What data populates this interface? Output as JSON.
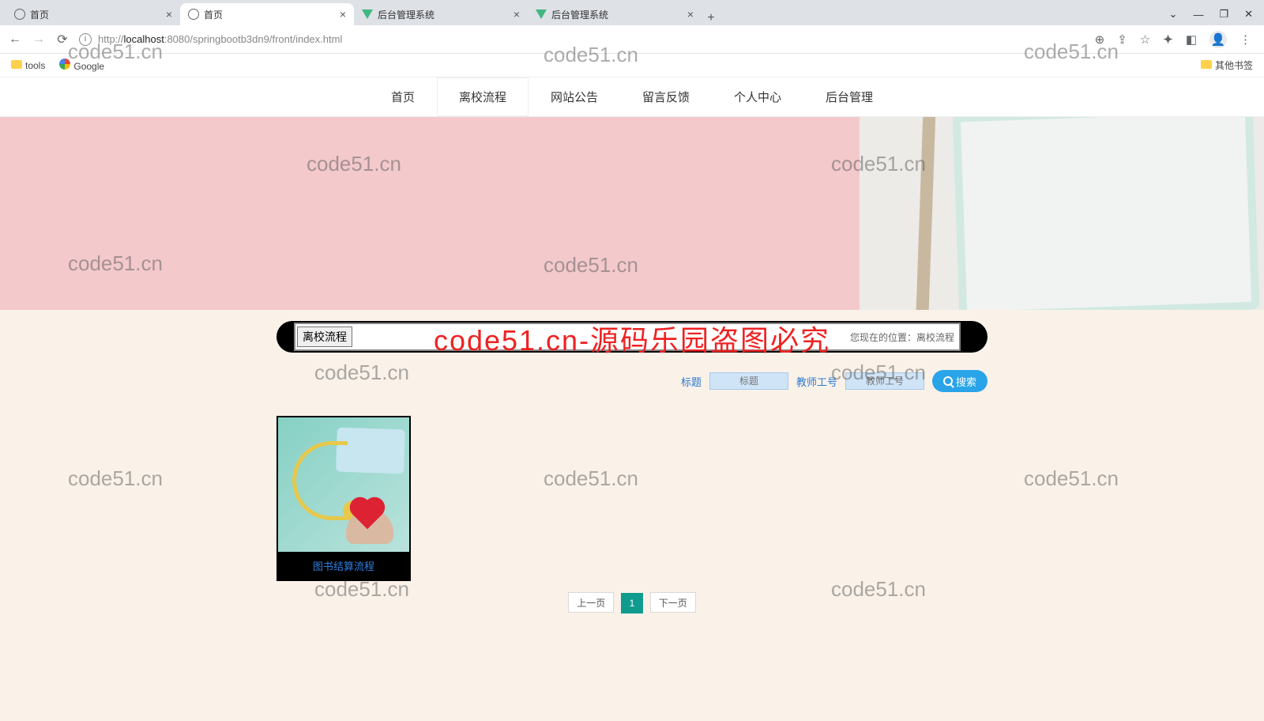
{
  "browser": {
    "tabs": [
      {
        "title": "首页",
        "favicon": "globe",
        "active": false
      },
      {
        "title": "首页",
        "favicon": "globe",
        "active": true
      },
      {
        "title": "后台管理系统",
        "favicon": "vue",
        "active": false
      },
      {
        "title": "后台管理系统",
        "favicon": "vue",
        "active": false
      }
    ],
    "url_prefix": "http://",
    "url_host": "localhost",
    "url_path": ":8080/springbootb3dn9/front/index.html",
    "bookmarks": {
      "tools": "tools",
      "google": "Google",
      "other": "其他书签"
    }
  },
  "nav": {
    "items": [
      "首页",
      "离校流程",
      "网站公告",
      "留言反馈",
      "个人中心",
      "后台管理"
    ],
    "active_index": 1
  },
  "section": {
    "title": "离校流程",
    "breadcrumb_label": "您现在的位置：",
    "breadcrumb_here": "离校流程"
  },
  "search": {
    "label1": "标题",
    "placeholder1": "标题",
    "label2": "教师工号",
    "placeholder2": "教师工号",
    "button": "搜索"
  },
  "cards": [
    {
      "caption": "图书结算流程"
    }
  ],
  "pager": {
    "prev": "上一页",
    "pages": [
      "1"
    ],
    "next": "下一页",
    "current": "1"
  },
  "watermark_text": "code51.cn",
  "watermark_red": "code51.cn-源码乐园盗图必究"
}
